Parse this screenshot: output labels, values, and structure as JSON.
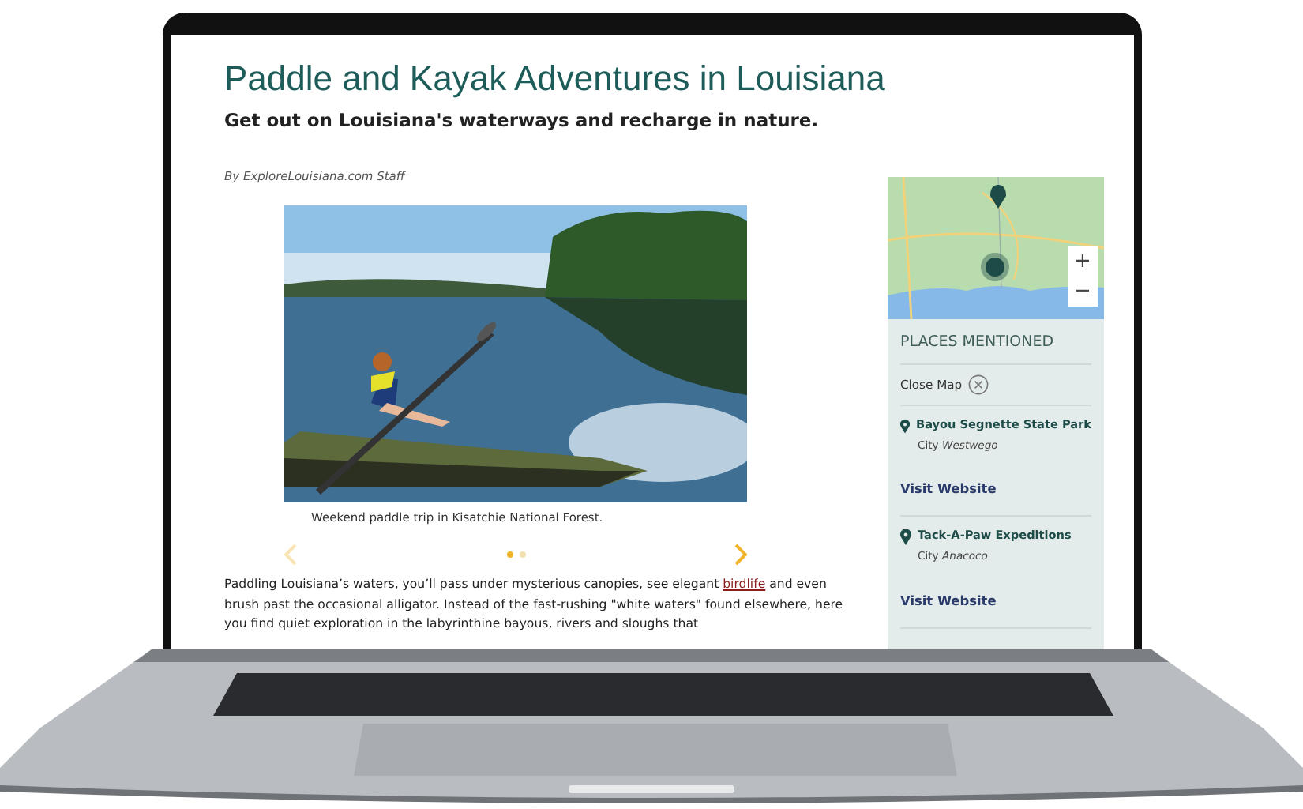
{
  "article": {
    "title": "Paddle and Kayak Adventures in Louisiana",
    "subtitle": "Get out on Louisiana's waterways and recharge in nature.",
    "byline": "By ExploreLouisiana.com Staff"
  },
  "gallery": {
    "caption": "Weekend paddle trip in Kisatchie National Forest.",
    "prev_disabled": true,
    "next_disabled": false,
    "dots": [
      {
        "selected": true
      },
      {
        "selected": false
      }
    ]
  },
  "body": {
    "before": "Paddling Louisiana’s waters, you’ll pass under mysterious canopies, see elegant ",
    "link": "birdlife",
    "after": " and even brush past the occasional alligator. Instead of the fast-rushing \"white waters\" found elsewhere, here you find quiet exploration in the labyrinthine bayous, rivers and sloughs that"
  },
  "map": {
    "zoom_in": "+",
    "zoom_out": "−"
  },
  "sidebar": {
    "heading": "PLACES MENTIONED",
    "close": "Close Map",
    "places": [
      {
        "name": "Bayou Segnette State Park",
        "city_label": "City",
        "city": "Westwego",
        "link": "Visit Website"
      },
      {
        "name": "Tack-A-Paw Expeditions",
        "city_label": "City",
        "city": "Anacoco",
        "link": "Visit Website"
      }
    ]
  }
}
